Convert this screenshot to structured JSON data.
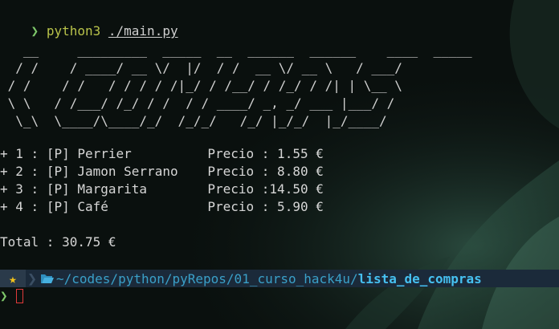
{
  "command": {
    "prompt_symbol": "❯",
    "program": "python3",
    "argument": "./main.py"
  },
  "banner": "   __     _________  _____  __  ______  ______    ____  _____\n  / /    / ____/ __ \\/  |/  / /  __ \\/ __ \\   / ___/\n / /    / /   / / / / /|_/ / /__/ / /_/ / /| | \\__ \\ \n \\ \\   / /___/ /_/ / /  / / ____/ _, _/ ___ |___/ / \n  \\_\\  \\____/\\____/_/  /_/_/   /_/ |_/_/  |_/____/  ",
  "items": [
    {
      "index": "1",
      "kind": "[P]",
      "name": "Perrier",
      "price_label": "Precio :",
      "price": " 1.55 €"
    },
    {
      "index": "2",
      "kind": "[P]",
      "name": "Jamon Serrano",
      "price_label": "Precio :",
      "price": " 8.80 €"
    },
    {
      "index": "3",
      "kind": "[P]",
      "name": "Margarita",
      "price_label": "Precio :",
      "price": "14.50 €"
    },
    {
      "index": "4",
      "kind": "[P]",
      "name": "Café",
      "price_label": "Precio :",
      "price": " 5.90 €"
    }
  ],
  "total": "Total : 30.75 €",
  "prompt": {
    "star_icon": "star-icon",
    "folder_icon": "folder-open-icon",
    "path": "~/codes/python/pyRepos/01_curso_hack4u/",
    "current_dir": "lista_de_compras",
    "prompt_symbol": "❯"
  },
  "colors": {
    "prompt_green": "#7ec86a",
    "command_yellow": "#b8c24a",
    "path_blue": "#3aa0c8",
    "star_yellow": "#f2c21b",
    "cursor_red": "#e03a3a"
  }
}
